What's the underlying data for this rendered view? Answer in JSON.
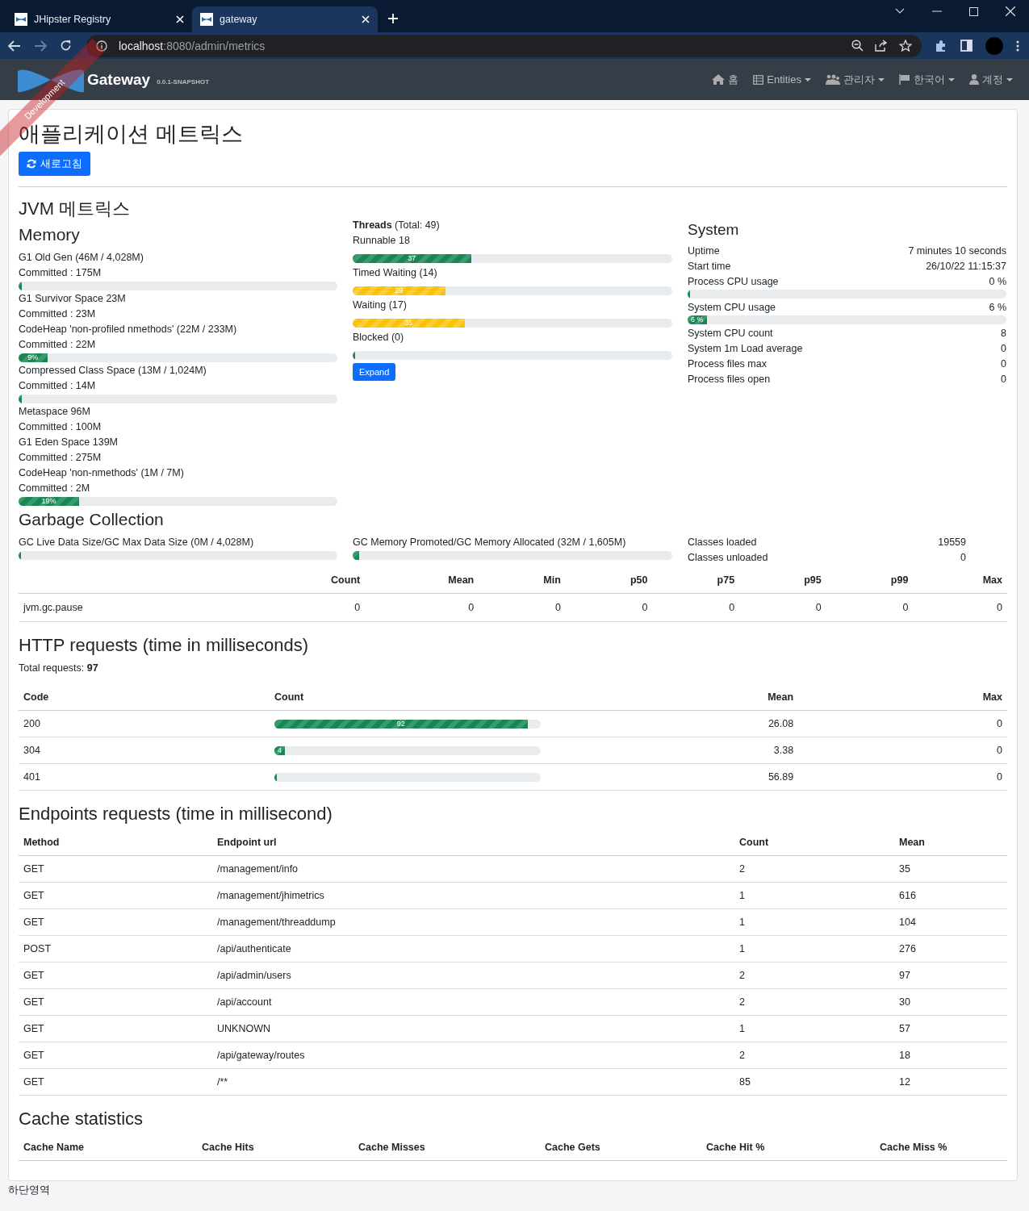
{
  "browser": {
    "tabs": [
      {
        "title": "JHipster Registry",
        "selected": false
      },
      {
        "title": "gateway",
        "selected": true
      }
    ],
    "url_host": "localhost",
    "url_path": ":8080/admin/metrics"
  },
  "navbar": {
    "brand": "Gateway",
    "version": "0.0.1-SNAPSHOT",
    "ribbon": "Development",
    "items": [
      {
        "kind": "home",
        "label": "홈",
        "dropdown": false
      },
      {
        "kind": "table",
        "label": "Entities",
        "dropdown": true
      },
      {
        "kind": "users",
        "label": "관리자",
        "dropdown": true
      },
      {
        "kind": "flag",
        "label": "한국어",
        "dropdown": true
      },
      {
        "kind": "user",
        "label": "계정",
        "dropdown": true
      }
    ]
  },
  "page_title": "애플리케이션 메트릭스",
  "refresh_button": "새로고침",
  "jvm": {
    "title": "JVM 메트릭스",
    "memory_title": "Memory",
    "memory": [
      {
        "name": "G1 Old Gen (46M / 4,028M)",
        "committed": "Committed : 175M",
        "bar": {
          "level": 0.01
        }
      },
      {
        "name": "G1 Survivor Space 23M",
        "committed": "Committed : 23M"
      },
      {
        "name": "CodeHeap 'non-profiled nmethods' (22M / 233M)",
        "committed": "Committed : 22M",
        "bar": {
          "level": 0.09,
          "label": "9%"
        }
      },
      {
        "name": "Compressed Class Space (13M / 1,024M)",
        "committed": "Committed : 14M",
        "bar": {
          "level": 0.01
        }
      },
      {
        "name": "Metaspace 96M",
        "committed": "Committed : 100M"
      },
      {
        "name": "G1 Eden Space 139M",
        "committed": "Committed : 275M"
      },
      {
        "name": "CodeHeap 'non-nmethods' (1M / 7M)",
        "committed": "Committed : 2M",
        "bar": {
          "level": 0.19,
          "label": "19%"
        }
      }
    ],
    "threads_title": "**Threads** (Total: 49)",
    "threads": [
      {
        "label": "Runnable 18",
        "bar": {
          "level": 0.37,
          "label": "37",
          "kind": "success"
        }
      },
      {
        "label": "Timed Waiting (14)",
        "bar": {
          "level": 0.29,
          "label": "29",
          "kind": "warning"
        }
      },
      {
        "label": "Waiting (17)",
        "bar": {
          "level": 0.35,
          "label": "35",
          "kind": "warning"
        }
      },
      {
        "label": "Blocked (0)",
        "bar": {
          "level": 0,
          "kind": "success"
        }
      }
    ],
    "expand_button": "Expand",
    "system_title": "System",
    "system": [
      {
        "label": "Uptime",
        "value": "7 minutes 10 seconds"
      },
      {
        "label": "Start time",
        "value": "26/10/22 11:15:37"
      },
      {
        "label": "Process CPU usage",
        "value": "0 %",
        "bar": {
          "level": 0.003
        }
      },
      {
        "label": "System CPU usage",
        "value": "6 %",
        "bar": {
          "level": 0.06,
          "label": "6 %"
        }
      },
      {
        "label": "System CPU count",
        "value": "8"
      },
      {
        "label": "System 1m Load average",
        "value": "0"
      },
      {
        "label": "Process files max",
        "value": "0"
      },
      {
        "label": "Process files open",
        "value": "0"
      }
    ]
  },
  "gc": {
    "title": "Garbage Collection",
    "bars": [
      {
        "label": "GC Live Data Size/GC Max Data Size (0M / 4,028M)",
        "level": 0
      },
      {
        "label": "GC Memory Promoted/GC Memory Allocated (32M / 1,605M)",
        "level": 0.02
      }
    ],
    "classes": [
      {
        "label": "Classes loaded",
        "value": "19559"
      },
      {
        "label": "Classes unloaded",
        "value": "0"
      }
    ],
    "columns": [
      "Count",
      "Mean",
      "Min",
      "p50",
      "p75",
      "p95",
      "p99",
      "Max"
    ],
    "rows": [
      {
        "name": "jvm.gc.pause",
        "values": [
          "0",
          "0",
          "0",
          "0",
          "0",
          "0",
          "0",
          "0"
        ]
      }
    ]
  },
  "http": {
    "title": "HTTP requests (time in milliseconds)",
    "total": "Total requests: **97**",
    "columns": [
      "Code",
      "Count",
      "Mean",
      "Max"
    ],
    "rows": [
      {
        "code": "200",
        "level": 0.95,
        "count_label": "92",
        "mean": "26.08",
        "max": "0"
      },
      {
        "code": "304",
        "level": 0.04,
        "count_label": "4",
        "mean": "3.38",
        "max": "0"
      },
      {
        "code": "401",
        "level": 0.01,
        "mean": "56.89",
        "max": "0"
      }
    ]
  },
  "endpoints": {
    "title": "Endpoints requests (time in millisecond)",
    "columns": [
      "Method",
      "Endpoint url",
      "Count",
      "Mean"
    ],
    "rows": [
      [
        "GET",
        "/management/info",
        "2",
        "35"
      ],
      [
        "GET",
        "/management/jhimetrics",
        "1",
        "616"
      ],
      [
        "GET",
        "/management/threaddump",
        "1",
        "104"
      ],
      [
        "POST",
        "/api/authenticate",
        "1",
        "276"
      ],
      [
        "GET",
        "/api/admin/users",
        "2",
        "97"
      ],
      [
        "GET",
        "/api/account",
        "2",
        "30"
      ],
      [
        "GET",
        "UNKNOWN",
        "1",
        "57"
      ],
      [
        "GET",
        "/api/gateway/routes",
        "2",
        "18"
      ],
      [
        "GET",
        "/**",
        "85",
        "12"
      ]
    ]
  },
  "cache": {
    "title": "Cache statistics",
    "columns": [
      "Cache Name",
      "Cache Hits",
      "Cache Misses",
      "Cache Gets",
      "Cache Hit %",
      "Cache Miss %"
    ]
  },
  "footer": "하단영역"
}
